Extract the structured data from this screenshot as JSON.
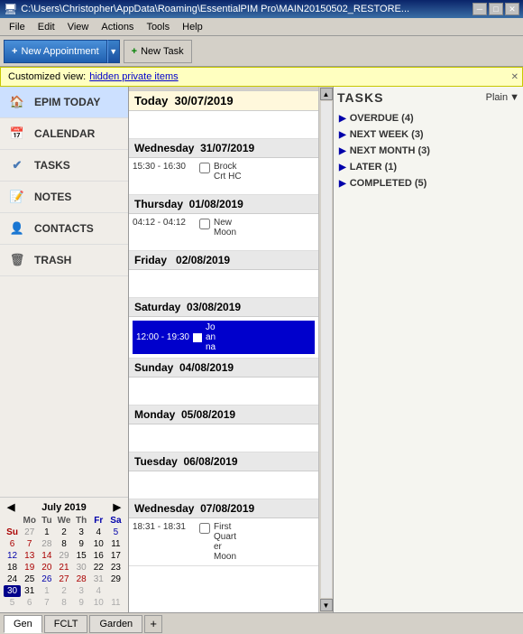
{
  "titlebar": {
    "text": "C:\\Users\\Christopher\\AppData\\Roaming\\EssentialPIM Pro\\MAIN20150502_RESTORE...",
    "min": "─",
    "max": "□",
    "close": "✕"
  },
  "menubar": {
    "items": [
      "File",
      "Edit",
      "View",
      "Actions",
      "Tools",
      "Help"
    ]
  },
  "toolbar": {
    "new_appointment": "New Appointment",
    "new_task": "New Task",
    "new_task_icon": "+"
  },
  "banner": {
    "prefix": "Customized view:",
    "link": "hidden private items"
  },
  "sidebar": {
    "items": [
      {
        "id": "epim-today",
        "label": "EPIM TODAY",
        "icon": "🏠"
      },
      {
        "id": "calendar",
        "label": "CALENDAR",
        "icon": "📅"
      },
      {
        "id": "tasks",
        "label": "TASKS",
        "icon": "✔"
      },
      {
        "id": "notes",
        "label": "NOTES",
        "icon": "📝"
      },
      {
        "id": "contacts",
        "label": "CONTACTS",
        "icon": "👤"
      },
      {
        "id": "trash",
        "label": "TRASH",
        "icon": "🗑"
      }
    ]
  },
  "mini_calendar": {
    "month_year": "July 2019",
    "day_headers": [
      "Mo",
      "Tu",
      "We",
      "Th",
      "Fr",
      "Sa",
      "Su"
    ],
    "weeks": [
      [
        "27",
        "1",
        "2",
        "3",
        "4",
        "5",
        "6",
        "7"
      ],
      [
        "28",
        "8",
        "9",
        "10",
        "11",
        "12",
        "13",
        "14"
      ],
      [
        "29",
        "15",
        "16",
        "17",
        "18",
        "19",
        "20",
        "21"
      ],
      [
        "30",
        "22",
        "23",
        "24",
        "25",
        "26",
        "27",
        "28"
      ],
      [
        "31",
        "29",
        "30",
        "31",
        "1",
        "2",
        "3",
        "4"
      ],
      [
        "",
        "5",
        "6",
        "7",
        "8",
        "9",
        "10",
        "11"
      ]
    ],
    "today_day": "30"
  },
  "calendar": {
    "days": [
      {
        "label": "Today   30/07/2019",
        "is_today": true,
        "events": []
      },
      {
        "label": "Wednesday  31/07/2019",
        "is_today": false,
        "events": [
          {
            "time": "15:30 - 16:30",
            "has_checkbox": true,
            "name": "Brock\nCrt HC"
          }
        ]
      },
      {
        "label": "Thursday  01/08/2019",
        "is_today": false,
        "events": [
          {
            "time": "04:12 - 04:12",
            "has_checkbox": true,
            "name": "New\nMoon"
          }
        ]
      },
      {
        "label": "Friday   02/08/2019",
        "is_today": false,
        "events": []
      },
      {
        "label": "Saturday  03/08/2019",
        "is_today": false,
        "events": [
          {
            "time": "12:00 - 19:30",
            "has_checkbox": true,
            "is_blue": true,
            "name": "Jo\nan\nna"
          }
        ]
      },
      {
        "label": "Sunday  04/08/2019",
        "is_today": false,
        "events": []
      },
      {
        "label": "Monday  05/08/2019",
        "is_today": false,
        "events": []
      },
      {
        "label": "Tuesday  06/08/2019",
        "is_today": false,
        "events": []
      },
      {
        "label": "Wednesday  07/08/2019",
        "is_today": false,
        "events": [
          {
            "time": "18:31 - 18:31",
            "has_checkbox": true,
            "name": "First\nQuart\ner\nMoon"
          }
        ]
      }
    ]
  },
  "tasks": {
    "title": "TASKS",
    "view_label": "Plain",
    "groups": [
      {
        "label": "OVERDUE (4)"
      },
      {
        "label": "NEXT WEEK (3)"
      },
      {
        "label": "NEXT MONTH (3)"
      },
      {
        "label": "LATER (1)"
      },
      {
        "label": "COMPLETED (5)"
      }
    ]
  },
  "bottom_tabs": {
    "tabs": [
      "Gen",
      "FCLT",
      "Garden"
    ],
    "add": "+"
  }
}
